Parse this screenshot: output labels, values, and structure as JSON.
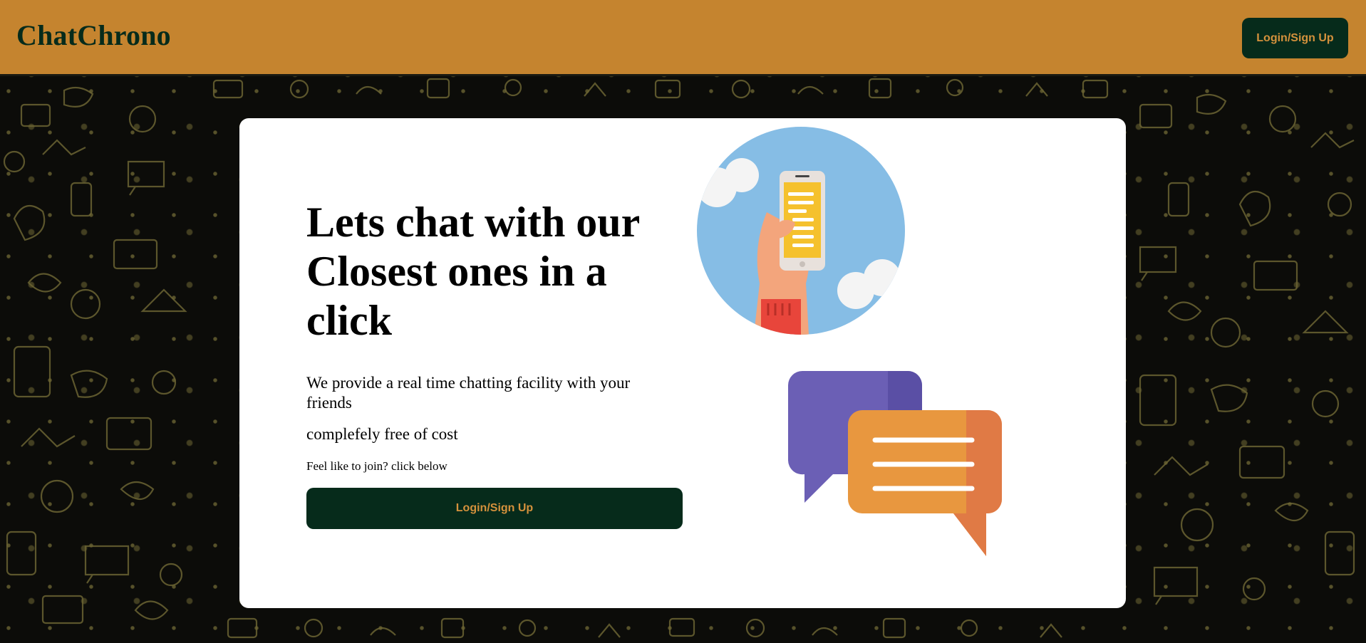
{
  "app": {
    "brand": "ChatChrono"
  },
  "navbar": {
    "login_label": "Login/Sign Up"
  },
  "hero": {
    "headline": "Lets chat with our Closest ones in a click",
    "description": "We provide a real time chatting facility with your friends",
    "free_text": "complefely free of cost",
    "join_prompt": "Feel like to join? click below",
    "cta_label": "Login/Sign Up"
  },
  "colors": {
    "navbar_bg": "#c5842f",
    "brand_text": "#062b1b",
    "button_bg": "#062b1b",
    "button_text": "#d4913c",
    "card_bg": "#ffffff",
    "page_bg": "#0c0c09"
  },
  "icons": {
    "phone_illustration": "hand-holding-phone-icon",
    "chat_illustration": "chat-bubbles-icon"
  }
}
